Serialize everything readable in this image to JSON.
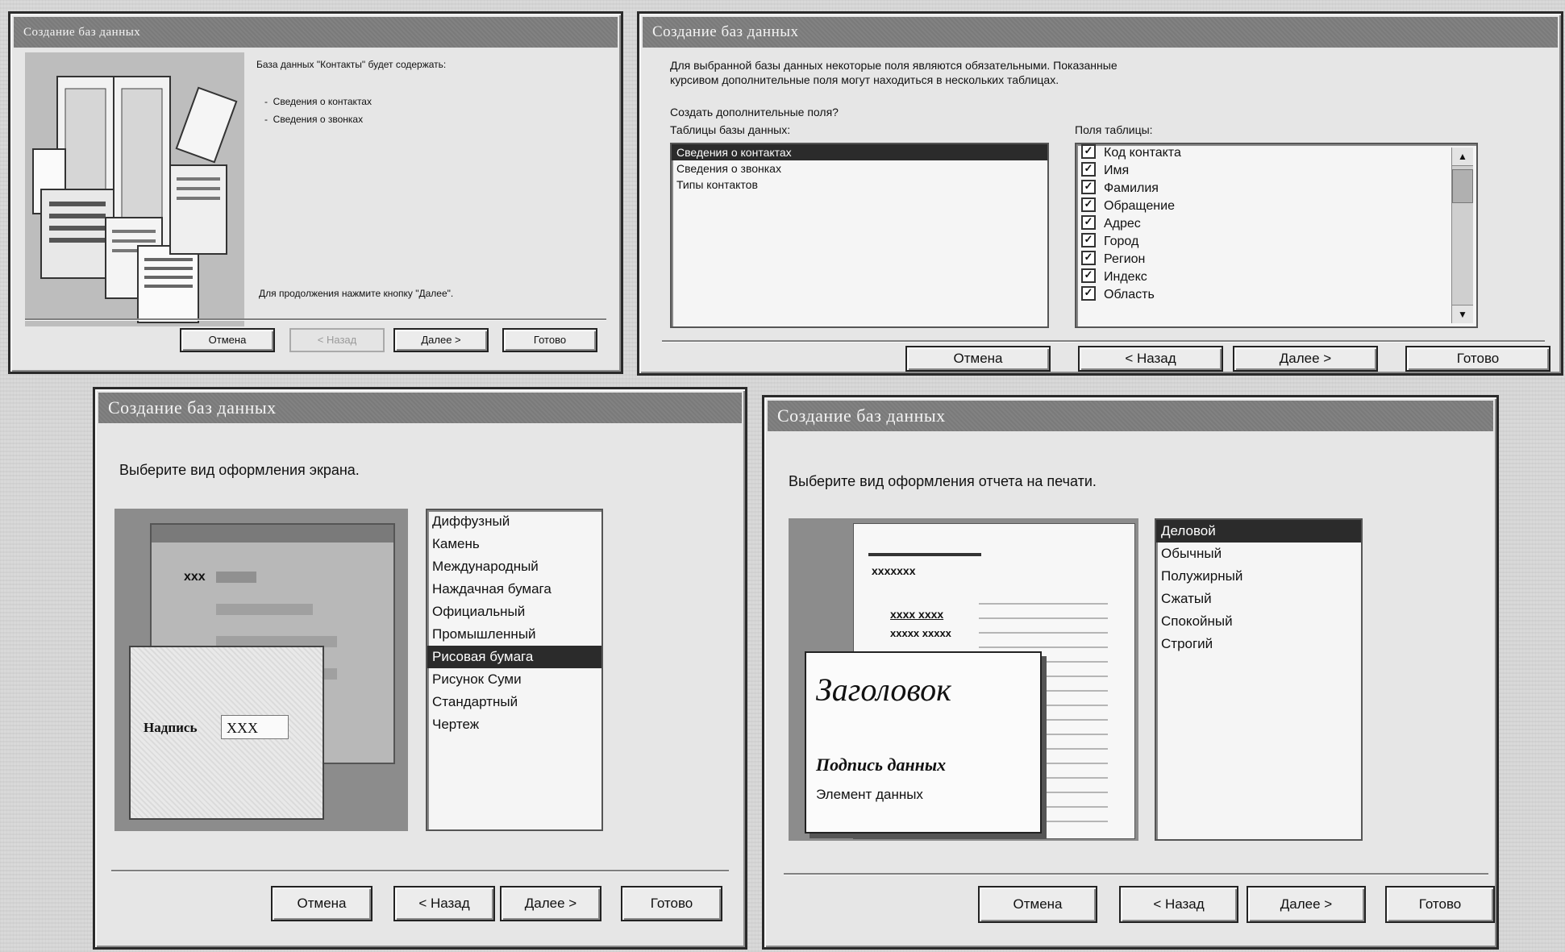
{
  "dialog1": {
    "title": "Создание баз данных",
    "intro": "База данных \"Контакты\" будет содержать:",
    "items": [
      "Сведения о контактах",
      "Сведения о звонках"
    ],
    "footer_note": "Для продолжения нажмите кнопку \"Далее\".",
    "buttons": {
      "cancel": "Отмена",
      "back": "< Назад",
      "next": "Далее >",
      "finish": "Готово"
    }
  },
  "dialog2": {
    "title": "Создание баз данных",
    "description_line1": "Для выбранной базы данных некоторые поля являются обязательными. Показанные",
    "description_line2": "курсивом дополнительные поля могут находиться в нескольких таблицах.",
    "question": "Создать дополнительные поля?",
    "tables_label": "Таблицы базы данных:",
    "fields_label": "Поля таблицы:",
    "tables": [
      "Сведения о контактах",
      "Сведения о звонках",
      "Типы контактов"
    ],
    "selected_table": 0,
    "fields": [
      "Код контакта",
      "Имя",
      "Фамилия",
      "Обращение",
      "Адрес",
      "Город",
      "Регион",
      "Индекс",
      "Область"
    ],
    "buttons": {
      "cancel": "Отмена",
      "back": "< Назад",
      "next": "Далее >",
      "finish": "Готово"
    }
  },
  "dialog3": {
    "title": "Создание баз данных",
    "prompt": "Выберите вид оформления экрана.",
    "styles": [
      "Диффузный",
      "Камень",
      "Международный",
      "Наждачная бумага",
      "Официальный",
      "Промышленный",
      "Рисовая бумага",
      "Рисунок Суми",
      "Стандартный",
      "Чертеж"
    ],
    "selected_style": 6,
    "preview_field_label": "Надпись",
    "preview_field_value": "XXX",
    "preview_xxx": "xxx",
    "buttons": {
      "cancel": "Отмена",
      "back": "< Назад",
      "next": "Далее >",
      "finish": "Готово"
    }
  },
  "dialog4": {
    "title": "Создание баз данных",
    "prompt": "Выберите вид оформления отчета на печати.",
    "styles": [
      "Деловой",
      "Обычный",
      "Полужирный",
      "Сжатый",
      "Спокойный",
      "Строгий"
    ],
    "selected_style": 0,
    "preview_heading": "Заголовок",
    "preview_caption": "Подпись данных",
    "preview_element": "Элемент данных",
    "preview_x1": "xxxxxxx",
    "preview_x2": "xxxx xxxx",
    "preview_x3": "xxxxx xxxxx",
    "buttons": {
      "cancel": "Отмена",
      "back": "< Назад",
      "next": "Далее >",
      "finish": "Готово"
    }
  }
}
